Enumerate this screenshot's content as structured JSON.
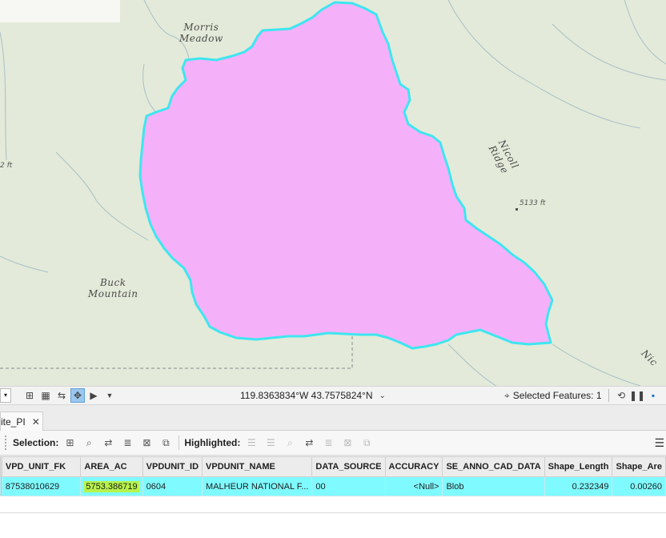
{
  "map": {
    "labels": {
      "morris_meadow": "Morris\nMeadow",
      "nicoll_ridge": "Nicoll Ridge",
      "buck_mountain": "Buck\nMountain",
      "elevation_5133": "5133 ft",
      "elevation_left": "2 ft",
      "nic_edge": "Nic"
    },
    "polygon_fill": "#f5b0fa",
    "polygon_stroke": "#3ee6f0"
  },
  "statusbar": {
    "coordinates": "119.8363834°W 43.7575824°N",
    "selected_features": "Selected Features: 1"
  },
  "tab": {
    "label": "ite_PI"
  },
  "toolbar": {
    "selection_label": "Selection:",
    "highlighted_label": "Highlighted:"
  },
  "table": {
    "columns": [
      "VPD_UNIT_FK",
      "AREA_AC",
      "VPDUNIT_ID",
      "VPDUNIT_NAME",
      "DATA_SOURCE",
      "ACCURACY",
      "SE_ANNO_CAD_DATA",
      "Shape_Length",
      "Shape_Are"
    ],
    "row": {
      "vpd_unit_fk": "87538010629",
      "area_ac": "5753.386719",
      "vpdunit_id": "0604",
      "vpdunit_name": "MALHEUR NATIONAL F...",
      "data_source": "00",
      "accuracy": "<Null>",
      "se_anno_cad_data": "Blob",
      "shape_length": "0.232349",
      "shape_area": "0.00260"
    }
  }
}
